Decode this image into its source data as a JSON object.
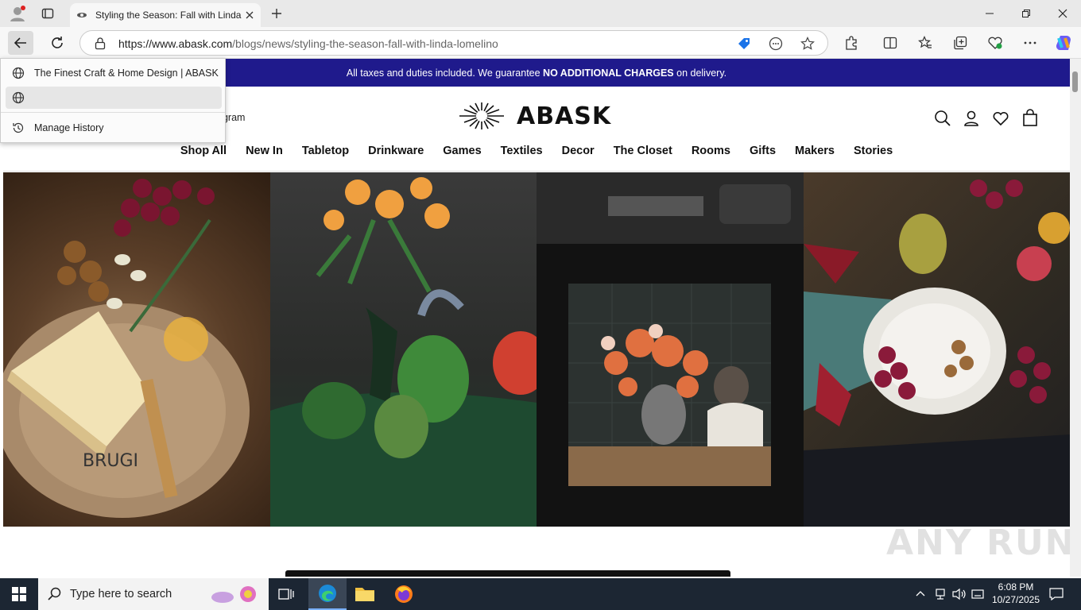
{
  "browser": {
    "tab_title": "Styling the Season: Fall with Linda",
    "url_host": "https://www.abask.com",
    "url_path": "/blogs/news/styling-the-season-fall-with-linda-lomelino"
  },
  "history_menu": {
    "items": [
      {
        "label": "The Finest Craft & Home Design | ABASK",
        "icon": "globe-icon"
      },
      {
        "label": "",
        "icon": "globe-icon"
      }
    ],
    "manage_label": "Manage History"
  },
  "page": {
    "banner_prefix": "All taxes and duties included. We guarantee ",
    "banner_bold": "NO ADDITIONAL CHARGES",
    "banner_suffix": " on delivery.",
    "banner_color": "#1f1a8c",
    "program_text": "ogram",
    "logo_text": "ABASK",
    "nav": [
      "Shop All",
      "New In",
      "Tabletop",
      "Drinkware",
      "Games",
      "Textiles",
      "Decor",
      "The Closet",
      "Rooms",
      "Gifts",
      "Makers",
      "Stories"
    ],
    "hero_panels": [
      "cheese-and-grapes-photo",
      "flowers-and-green-teapot-photo",
      "flower-vase-still-life-photo",
      "fig-plate-and-grapes-photo"
    ]
  },
  "taskbar": {
    "search_placeholder": "Type here to search",
    "time": "6:08 PM",
    "date": "10/27/2025"
  },
  "watermark": "ANY RUN"
}
